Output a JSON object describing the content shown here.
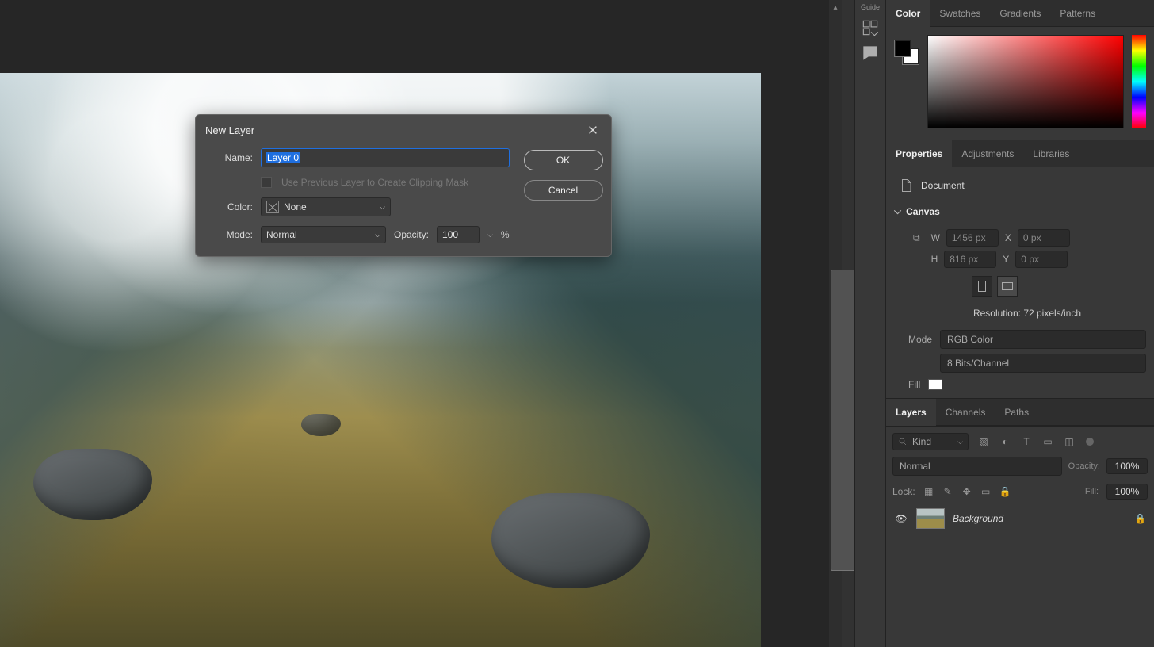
{
  "icon_strip": {
    "guide_label": "Guide"
  },
  "color_panel": {
    "tabs": {
      "color": "Color",
      "swatches": "Swatches",
      "gradients": "Gradients",
      "patterns": "Patterns"
    },
    "fg": "#000000",
    "bg": "#ffffff"
  },
  "properties_panel": {
    "tabs": {
      "properties": "Properties",
      "adjustments": "Adjustments",
      "libraries": "Libraries"
    },
    "document_label": "Document",
    "canvas": {
      "title": "Canvas",
      "w_label": "W",
      "w_value": "1456 px",
      "h_label": "H",
      "h_value": "816 px",
      "x_label": "X",
      "x_value": "0 px",
      "y_label": "Y",
      "y_value": "0 px",
      "resolution_label": "Resolution: 72 pixels/inch",
      "mode_label": "Mode",
      "mode_value": "RGB Color",
      "bits_value": "8 Bits/Channel",
      "fill_label": "Fill"
    }
  },
  "layers_panel": {
    "tabs": {
      "layers": "Layers",
      "channels": "Channels",
      "paths": "Paths"
    },
    "kind_label": "Kind",
    "blend_mode": "Normal",
    "opacity_label": "Opacity:",
    "opacity_value": "100%",
    "lock_label": "Lock:",
    "fill_label": "Fill:",
    "fill_value": "100%",
    "layer_name": "Background"
  },
  "dialog": {
    "title": "New Layer",
    "name_label": "Name:",
    "name_value": "Layer 0",
    "clip_label": "Use Previous Layer to Create Clipping Mask",
    "color_label": "Color:",
    "color_value": "None",
    "mode_label": "Mode:",
    "mode_value": "Normal",
    "opacity_label": "Opacity:",
    "opacity_value": "100",
    "percent": "%",
    "ok": "OK",
    "cancel": "Cancel"
  }
}
